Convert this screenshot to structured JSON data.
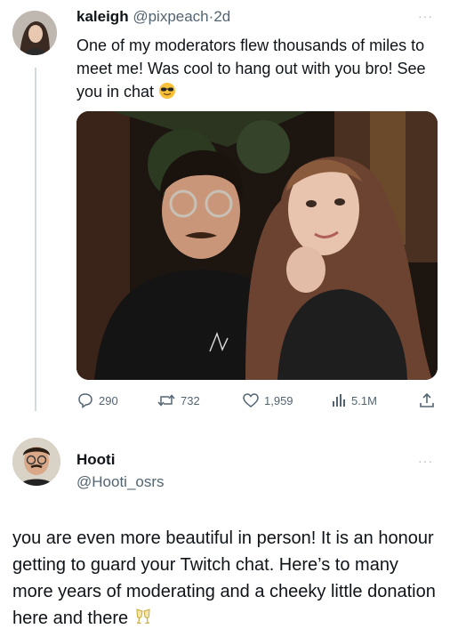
{
  "tweet": {
    "author_name": "kaleigh",
    "author_handle": "@pixpeach",
    "separator": "·",
    "age": "2d",
    "text": "One of my moderators flew thousands of miles to meet me! Was cool to hang out with you bro! See you in chat",
    "text_emoji": "smiling-face-with-sunglasses",
    "more_label": "···",
    "stats": {
      "replies": "290",
      "reposts": "732",
      "likes": "1,959",
      "views": "5.1M"
    }
  },
  "reply": {
    "author_name": "Hooti",
    "author_handle": "@Hooti_osrs",
    "more_label": "···",
    "text": "you are even more beautiful in person! It is an honour getting to guard your Twitch chat. Here’s to many more years of moderating and a cheeky little donation here and there",
    "text_emoji": "clinking-glasses"
  },
  "colors": {
    "text": "#0f1419",
    "muted": "#536471",
    "thread_line": "#cfd9de"
  }
}
